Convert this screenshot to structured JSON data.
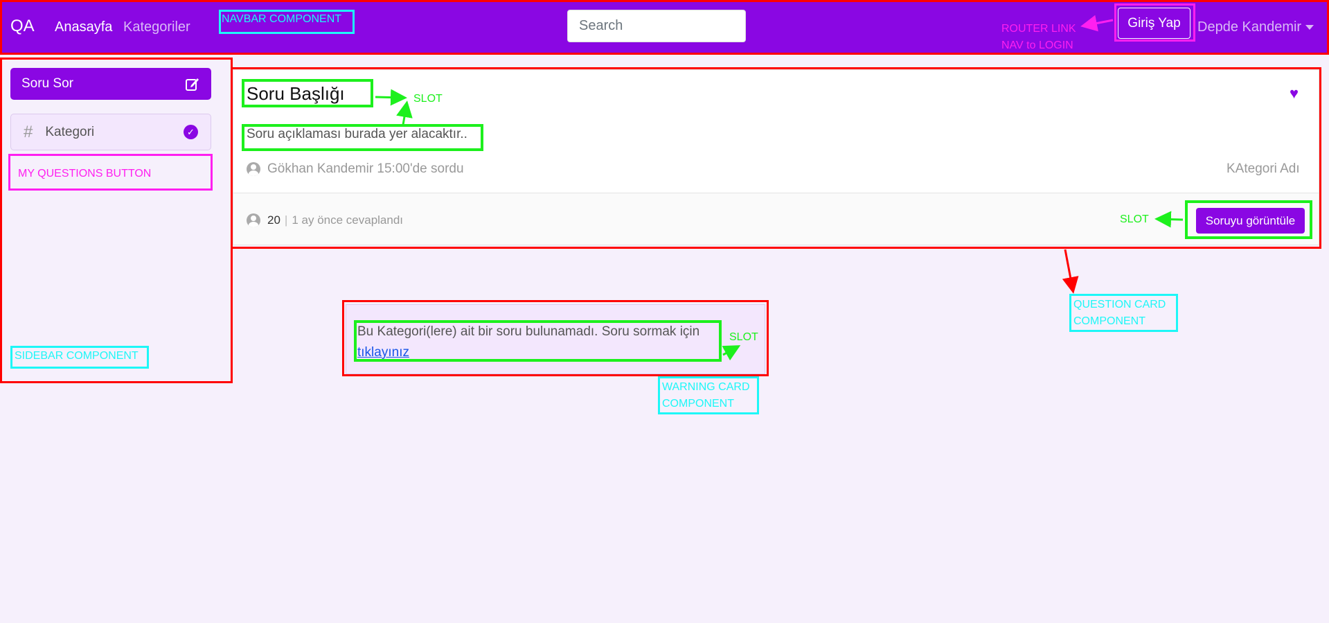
{
  "navbar": {
    "brand": "QA",
    "links": [
      "Anasayfa",
      "Kategoriler"
    ],
    "search_placeholder": "Search",
    "login_label": "Giriş Yap",
    "user_name": "Depde Kandemir"
  },
  "sidebar": {
    "ask_label": "Soru Sor",
    "category_label": "Kategori"
  },
  "question": {
    "title": "Soru Başlığı",
    "description": "Soru açıklaması burada yer alacaktır..",
    "meta": "Gökhan Kandemir 15:00'de sordu",
    "category": "KAtegori Adı",
    "answer_count": "20",
    "answered_at": "1 ay önce cevaplandı",
    "view_label": "Soruyu görüntüle"
  },
  "warning": {
    "text": "Bu Kategori(lere) ait bir soru bulunamadı. Soru sormak için",
    "link": "tıklayınız"
  },
  "annotations": {
    "navbar_component": "NAVBAR COMPONENT",
    "router_link": "ROUTER LINK",
    "nav_to_login": "NAV to LOGIN",
    "my_questions_button": "MY QUESTIONS BUTTON",
    "sidebar_component": "SIDEBAR COMPONENT",
    "slot": "SLOT",
    "question_card_line1": "QUESTION CARD",
    "question_card_line2": "COMPONENT",
    "warning_card_line1": "WARNING CARD",
    "warning_card_line2": "COMPONENT"
  },
  "colors": {
    "brand_purple": "#8a07e3",
    "background": "#f6f0fc",
    "annotation_red": "#ff0000",
    "annotation_green": "#1df01d",
    "annotation_cyan": "#1ef7f7",
    "annotation_magenta": "#ff1ff0"
  }
}
